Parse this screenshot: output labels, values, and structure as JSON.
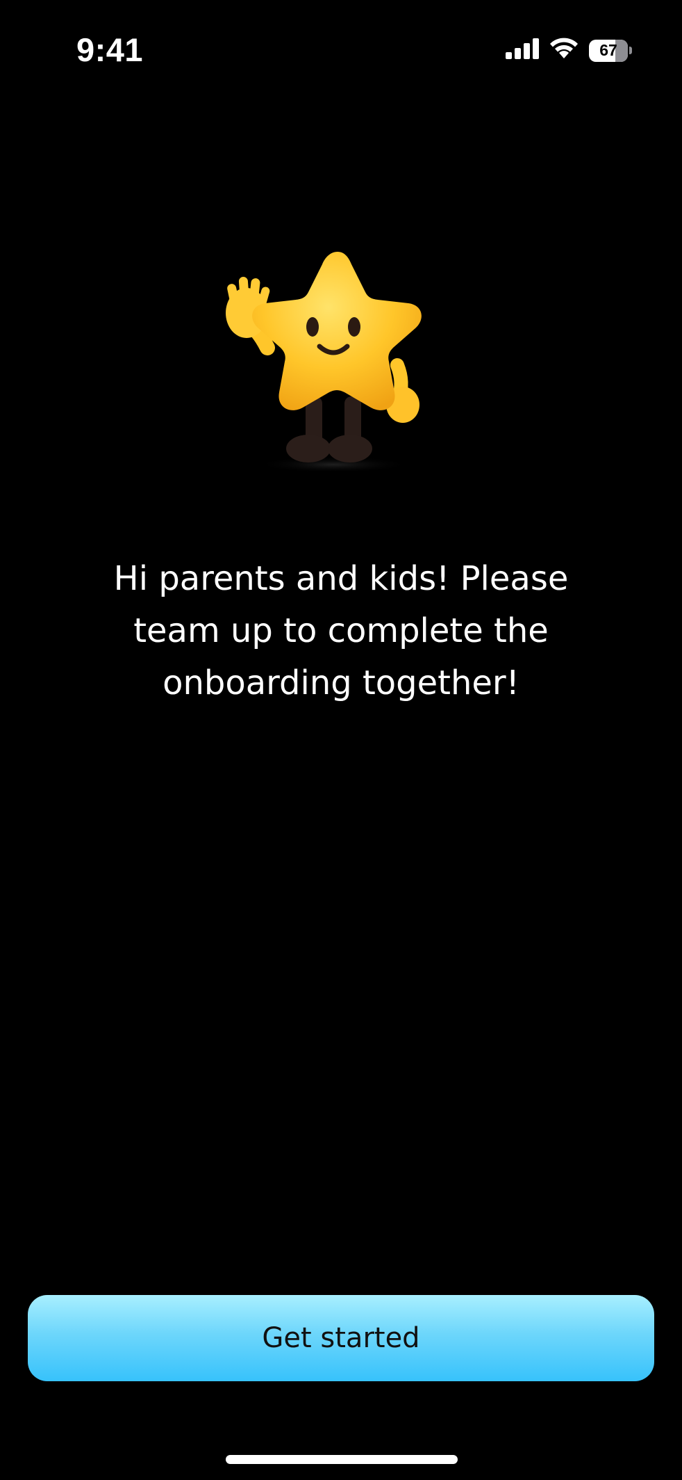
{
  "status_bar": {
    "time": "9:41",
    "battery_level": "67",
    "icons": [
      "cellular-signal-icon",
      "wifi-icon",
      "battery-icon"
    ]
  },
  "mascot": {
    "icon": "waving-star-mascot-icon"
  },
  "onboarding": {
    "message": "Hi parents and kids! Please team up to complete the onboarding together!"
  },
  "actions": {
    "get_started_label": "Get started"
  },
  "colors": {
    "background": "#000000",
    "button_gradient_top": "#a8efff",
    "button_gradient_bottom": "#37c2fb",
    "mascot_yellow": "#ffc62a"
  }
}
